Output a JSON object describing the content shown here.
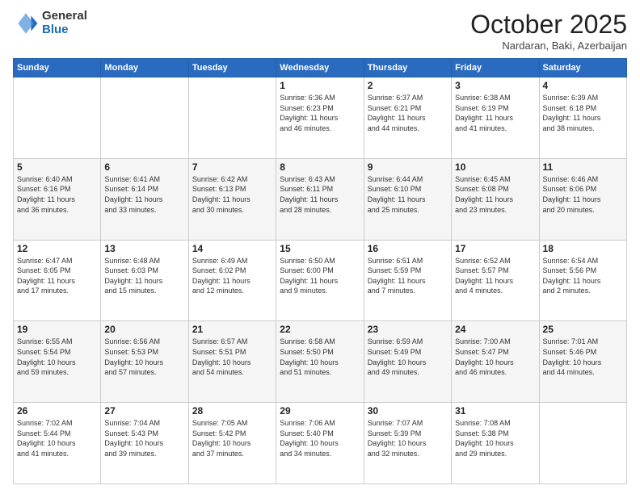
{
  "header": {
    "logo_general": "General",
    "logo_blue": "Blue",
    "month_title": "October 2025",
    "location": "Nardaran, Baki, Azerbaijan"
  },
  "weekdays": [
    "Sunday",
    "Monday",
    "Tuesday",
    "Wednesday",
    "Thursday",
    "Friday",
    "Saturday"
  ],
  "weeks": [
    [
      {
        "day": "",
        "text": ""
      },
      {
        "day": "",
        "text": ""
      },
      {
        "day": "",
        "text": ""
      },
      {
        "day": "1",
        "text": "Sunrise: 6:36 AM\nSunset: 6:23 PM\nDaylight: 11 hours\nand 46 minutes."
      },
      {
        "day": "2",
        "text": "Sunrise: 6:37 AM\nSunset: 6:21 PM\nDaylight: 11 hours\nand 44 minutes."
      },
      {
        "day": "3",
        "text": "Sunrise: 6:38 AM\nSunset: 6:19 PM\nDaylight: 11 hours\nand 41 minutes."
      },
      {
        "day": "4",
        "text": "Sunrise: 6:39 AM\nSunset: 6:18 PM\nDaylight: 11 hours\nand 38 minutes."
      }
    ],
    [
      {
        "day": "5",
        "text": "Sunrise: 6:40 AM\nSunset: 6:16 PM\nDaylight: 11 hours\nand 36 minutes."
      },
      {
        "day": "6",
        "text": "Sunrise: 6:41 AM\nSunset: 6:14 PM\nDaylight: 11 hours\nand 33 minutes."
      },
      {
        "day": "7",
        "text": "Sunrise: 6:42 AM\nSunset: 6:13 PM\nDaylight: 11 hours\nand 30 minutes."
      },
      {
        "day": "8",
        "text": "Sunrise: 6:43 AM\nSunset: 6:11 PM\nDaylight: 11 hours\nand 28 minutes."
      },
      {
        "day": "9",
        "text": "Sunrise: 6:44 AM\nSunset: 6:10 PM\nDaylight: 11 hours\nand 25 minutes."
      },
      {
        "day": "10",
        "text": "Sunrise: 6:45 AM\nSunset: 6:08 PM\nDaylight: 11 hours\nand 23 minutes."
      },
      {
        "day": "11",
        "text": "Sunrise: 6:46 AM\nSunset: 6:06 PM\nDaylight: 11 hours\nand 20 minutes."
      }
    ],
    [
      {
        "day": "12",
        "text": "Sunrise: 6:47 AM\nSunset: 6:05 PM\nDaylight: 11 hours\nand 17 minutes."
      },
      {
        "day": "13",
        "text": "Sunrise: 6:48 AM\nSunset: 6:03 PM\nDaylight: 11 hours\nand 15 minutes."
      },
      {
        "day": "14",
        "text": "Sunrise: 6:49 AM\nSunset: 6:02 PM\nDaylight: 11 hours\nand 12 minutes."
      },
      {
        "day": "15",
        "text": "Sunrise: 6:50 AM\nSunset: 6:00 PM\nDaylight: 11 hours\nand 9 minutes."
      },
      {
        "day": "16",
        "text": "Sunrise: 6:51 AM\nSunset: 5:59 PM\nDaylight: 11 hours\nand 7 minutes."
      },
      {
        "day": "17",
        "text": "Sunrise: 6:52 AM\nSunset: 5:57 PM\nDaylight: 11 hours\nand 4 minutes."
      },
      {
        "day": "18",
        "text": "Sunrise: 6:54 AM\nSunset: 5:56 PM\nDaylight: 11 hours\nand 2 minutes."
      }
    ],
    [
      {
        "day": "19",
        "text": "Sunrise: 6:55 AM\nSunset: 5:54 PM\nDaylight: 10 hours\nand 59 minutes."
      },
      {
        "day": "20",
        "text": "Sunrise: 6:56 AM\nSunset: 5:53 PM\nDaylight: 10 hours\nand 57 minutes."
      },
      {
        "day": "21",
        "text": "Sunrise: 6:57 AM\nSunset: 5:51 PM\nDaylight: 10 hours\nand 54 minutes."
      },
      {
        "day": "22",
        "text": "Sunrise: 6:58 AM\nSunset: 5:50 PM\nDaylight: 10 hours\nand 51 minutes."
      },
      {
        "day": "23",
        "text": "Sunrise: 6:59 AM\nSunset: 5:49 PM\nDaylight: 10 hours\nand 49 minutes."
      },
      {
        "day": "24",
        "text": "Sunrise: 7:00 AM\nSunset: 5:47 PM\nDaylight: 10 hours\nand 46 minutes."
      },
      {
        "day": "25",
        "text": "Sunrise: 7:01 AM\nSunset: 5:46 PM\nDaylight: 10 hours\nand 44 minutes."
      }
    ],
    [
      {
        "day": "26",
        "text": "Sunrise: 7:02 AM\nSunset: 5:44 PM\nDaylight: 10 hours\nand 41 minutes."
      },
      {
        "day": "27",
        "text": "Sunrise: 7:04 AM\nSunset: 5:43 PM\nDaylight: 10 hours\nand 39 minutes."
      },
      {
        "day": "28",
        "text": "Sunrise: 7:05 AM\nSunset: 5:42 PM\nDaylight: 10 hours\nand 37 minutes."
      },
      {
        "day": "29",
        "text": "Sunrise: 7:06 AM\nSunset: 5:40 PM\nDaylight: 10 hours\nand 34 minutes."
      },
      {
        "day": "30",
        "text": "Sunrise: 7:07 AM\nSunset: 5:39 PM\nDaylight: 10 hours\nand 32 minutes."
      },
      {
        "day": "31",
        "text": "Sunrise: 7:08 AM\nSunset: 5:38 PM\nDaylight: 10 hours\nand 29 minutes."
      },
      {
        "day": "",
        "text": ""
      }
    ]
  ]
}
